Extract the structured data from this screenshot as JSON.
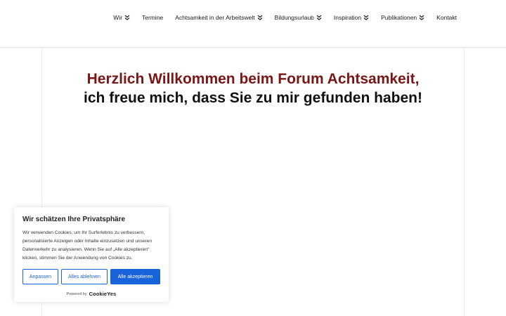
{
  "nav": {
    "items": [
      {
        "label": "Wir",
        "dropdown": true
      },
      {
        "label": "Termine",
        "dropdown": false
      },
      {
        "label": "Achtsamkeit in der Arbeitswelt",
        "dropdown": true
      },
      {
        "label": "Bildungsurlaub",
        "dropdown": true
      },
      {
        "label": "Inspiration",
        "dropdown": true
      },
      {
        "label": "Publikationen",
        "dropdown": true
      },
      {
        "label": "Kontakt",
        "dropdown": false
      }
    ]
  },
  "hero": {
    "line1": "Herzlich Willkommen beim Forum Achtsamkeit,",
    "line2": "ich freue mich, dass Sie zu mir gefunden haben!"
  },
  "cookie": {
    "title": "Wir schätzen Ihre Privatsphäre",
    "text_lines": [
      "Wir verwenden Cookies, um Ihr Surferlebnis zu verbessern,",
      "personalisierte Anzeigen oder Inhalte einzusetzen und unseren",
      "Datenverkehr zu analysieren. Wenn Sie auf „Alle akzeptieren“",
      "klicken, stimmen Sie der Anwendung von Cookies zu."
    ],
    "btn_customize": "Anpassen",
    "btn_reject": "Alles ablehnen",
    "btn_accept": "Alle akzeptieren",
    "powered_by": "Powered by",
    "brand": "CookieYes"
  },
  "colors": {
    "accent_red": "#7b1616",
    "button_blue": "#1863dc"
  }
}
